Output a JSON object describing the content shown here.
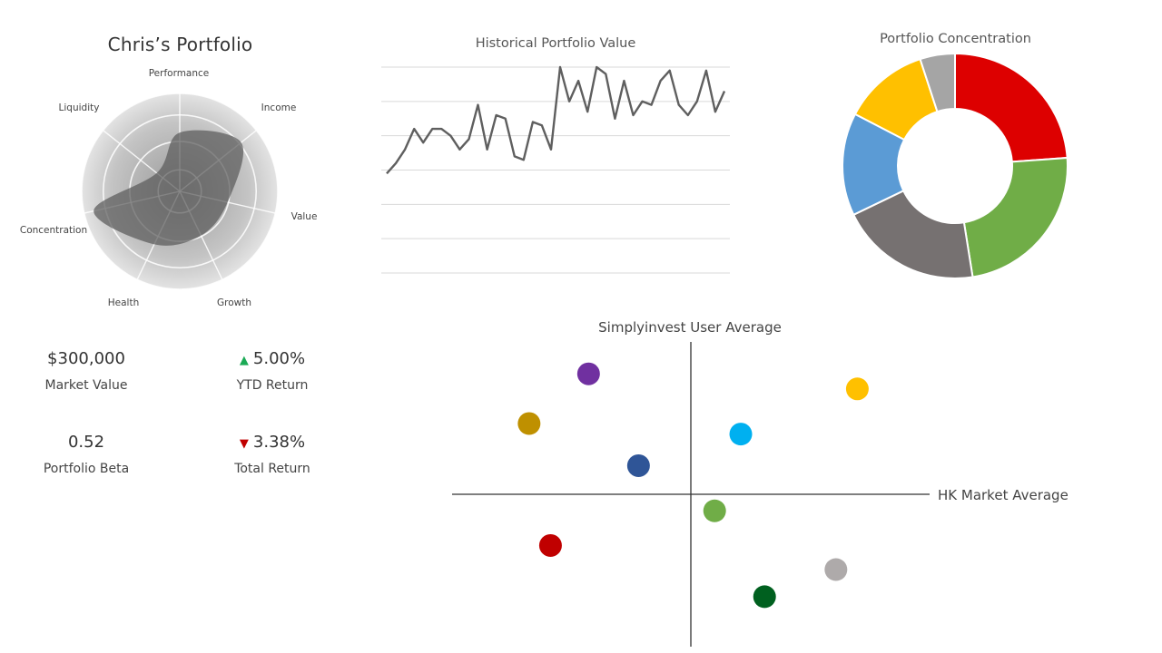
{
  "header": {
    "title": "Chris’s Portfolio"
  },
  "metrics": {
    "market_value": {
      "value": "$300,000",
      "label": "Market Value"
    },
    "ytd_return": {
      "value": "5.00%",
      "label": "YTD Return",
      "arrow": "▲",
      "direction": "up",
      "color": "#1aaa55"
    },
    "beta": {
      "value": "0.52",
      "label": "Portfolio Beta"
    },
    "total_return": {
      "value": "3.38%",
      "label": "Total Return",
      "arrow": "▼",
      "direction": "down",
      "color": "#c00000"
    }
  },
  "chart_data": [
    {
      "type": "radar",
      "axes": [
        "Performance",
        "Income",
        "Value",
        "Growth",
        "Health",
        "Concentration",
        "Liquidity"
      ],
      "values": [
        0.6,
        0.8,
        0.5,
        0.5,
        0.6,
        0.9,
        0.3
      ],
      "range": [
        0,
        1
      ],
      "rings": 4,
      "fill_color": "#5a5a5a"
    },
    {
      "type": "line",
      "title": "Historical Portfolio Value",
      "values": [
        2.9,
        3.2,
        3.6,
        4.2,
        3.8,
        4.2,
        4.2,
        4.0,
        3.6,
        3.9,
        4.9,
        3.6,
        4.6,
        4.5,
        3.4,
        3.3,
        4.4,
        4.3,
        3.6,
        6.0,
        5.0,
        5.6,
        4.7,
        6.0,
        5.8,
        4.5,
        5.6,
        4.6,
        5.0,
        4.9,
        5.6,
        5.9,
        4.9,
        4.6,
        5.0,
        5.9,
        4.7,
        5.3
      ],
      "ylim": [
        0,
        6
      ],
      "grid": true,
      "line_color": "#5f5f5f"
    },
    {
      "type": "pie",
      "subtype": "donut",
      "title": "Portfolio Concentration",
      "values": [
        24.7,
        24.5,
        21.1,
        15.3,
        12.8,
        5.2
      ],
      "colors": [
        "#dd0000",
        "#70ad47",
        "#767171",
        "#5b9bd5",
        "#ffc000",
        "#a5a5a5"
      ]
    },
    {
      "type": "scatter",
      "y_axis_label": "Simplyinvest User Average",
      "x_axis_label": "HK Market Average",
      "xlim": [
        -10,
        10
      ],
      "ylim": [
        -10,
        10
      ],
      "points": [
        {
          "x": -4.3,
          "y": 8.0,
          "color": "#7030a0"
        },
        {
          "x": 7.0,
          "y": 7.0,
          "color": "#ffc000"
        },
        {
          "x": -6.8,
          "y": 4.7,
          "color": "#bf9000"
        },
        {
          "x": 2.1,
          "y": 4.0,
          "color": "#00b0f0"
        },
        {
          "x": -2.2,
          "y": 1.9,
          "color": "#2f5597"
        },
        {
          "x": 1.0,
          "y": -1.1,
          "color": "#70ad47"
        },
        {
          "x": -5.9,
          "y": -3.4,
          "color": "#c00000"
        },
        {
          "x": 6.1,
          "y": -5.0,
          "color": "#aeaaaa"
        },
        {
          "x": 3.1,
          "y": -6.8,
          "color": "#00601f"
        }
      ]
    }
  ]
}
